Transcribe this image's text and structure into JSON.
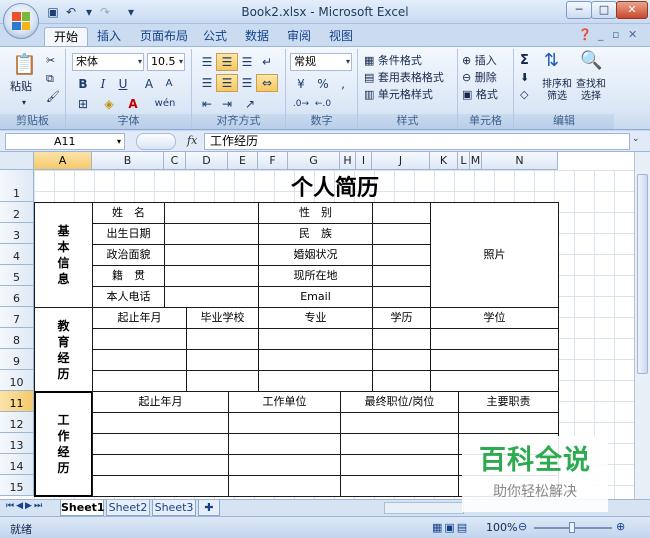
{
  "window": {
    "title": "Book2.xlsx - Microsoft Excel"
  },
  "tabs": [
    "开始",
    "插入",
    "页面布局",
    "公式",
    "数据",
    "审阅",
    "视图"
  ],
  "ribbon": {
    "clipboard": {
      "paste": "粘贴",
      "label": "剪贴板"
    },
    "font": {
      "name": "宋体",
      "size": "10.5",
      "bold": "B",
      "italic": "I",
      "underline": "U",
      "grow": "A",
      "shrink": "A",
      "wen": "wén",
      "label": "字体"
    },
    "alignment": {
      "label": "对齐方式"
    },
    "number": {
      "format": "常规",
      "percent": "%",
      "comma": ",",
      "label": "数字"
    },
    "styles": {
      "conditional": "条件格式",
      "table": "套用表格格式",
      "cell": "单元格样式",
      "label": "样式"
    },
    "cells": {
      "insert": "插入",
      "delete": "删除",
      "format": "格式",
      "label": "单元格"
    },
    "editing": {
      "sum": "Σ",
      "sort": "排序和\n筛选",
      "find": "查找和\n选择",
      "label": "编辑"
    }
  },
  "formula_bar": {
    "name_box": "A11",
    "fx": "fx",
    "value": "工作经历"
  },
  "columns": [
    "A",
    "B",
    "C",
    "D",
    "E",
    "F",
    "G",
    "H",
    "I",
    "J",
    "K",
    "L",
    "M",
    "N"
  ],
  "rows": [
    "1",
    "2",
    "3",
    "4",
    "5",
    "6",
    "7",
    "8",
    "9",
    "10",
    "11",
    "12",
    "13",
    "14",
    "15"
  ],
  "resume": {
    "title": "个人简历",
    "basic_header": "基本信息",
    "name_label": "姓　名",
    "gender_label": "性　别",
    "birth_label": "出生日期",
    "ethnicity_label": "民　族",
    "politics_label": "政治面貌",
    "marital_label": "婚姻状况",
    "origin_label": "籍　贯",
    "location_label": "现所在地",
    "phone_label": "本人电话",
    "email_label": "Email",
    "photo_label": "照片",
    "edu_header": "教育经历",
    "edu_period": "起止年月",
    "edu_school": "毕业学校",
    "edu_major": "专业",
    "edu_degree": "学历",
    "edu_level": "学位",
    "work_header": "工作经历",
    "work_period": "起止年月",
    "work_company": "工作单位",
    "work_position": "最终职位/岗位",
    "work_duty": "主要职责"
  },
  "sheets": [
    "Sheet1",
    "Sheet2",
    "Sheet3"
  ],
  "status": {
    "ready": "就绪",
    "zoom": "100%"
  },
  "watermark": {
    "title": "百科全说",
    "subtitle": "助你轻松解决"
  }
}
